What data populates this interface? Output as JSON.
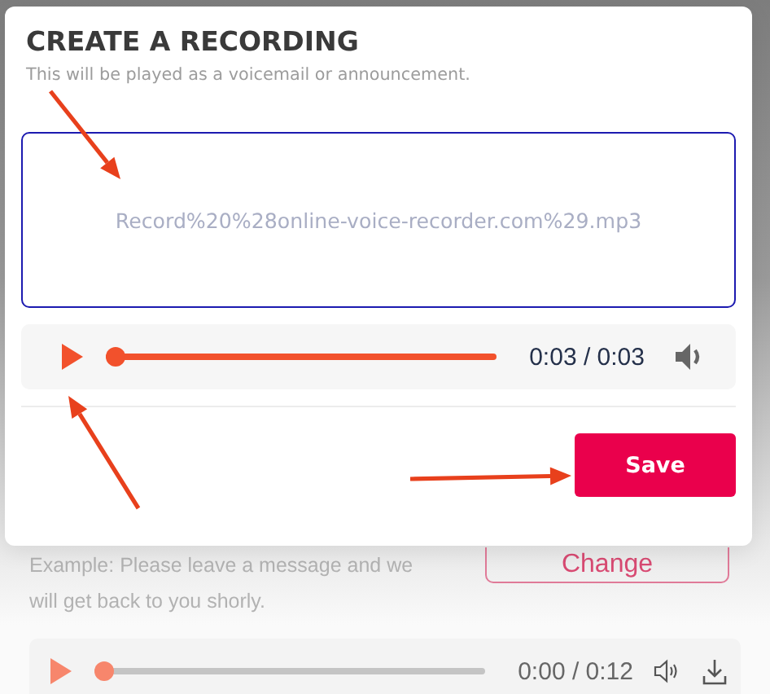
{
  "dialog": {
    "title": "CREATE A RECORDING",
    "subtitle": "This will be played as a voicemail or announcement.",
    "file_name": "Record%20%28online-voice-recorder.com%29.mp3",
    "player": {
      "time": "0:03 / 0:03",
      "level": 0
    },
    "save_button": "Save"
  },
  "background": {
    "example": "Example: Please leave a message and we will get back to you shorly.",
    "change_button": "Change",
    "player": {
      "time": "0:00 / 0:12",
      "level": 0
    }
  }
}
